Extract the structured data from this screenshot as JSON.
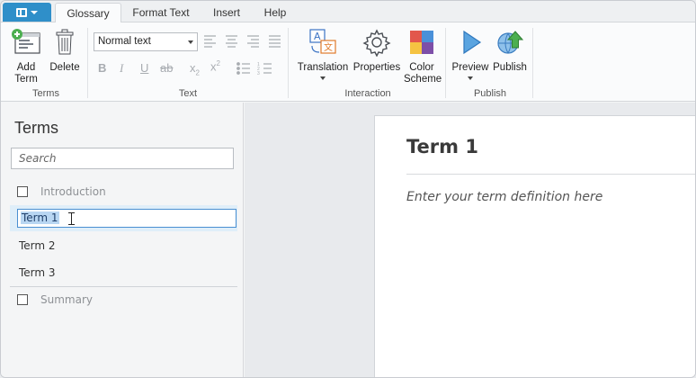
{
  "tabs": [
    "Glossary",
    "Format Text",
    "Insert",
    "Help"
  ],
  "ribbon": {
    "terms_group": {
      "label": "Terms",
      "add_term": "Add Term",
      "add_term_l1": "Add",
      "add_term_l2": "Term",
      "delete": "Delete"
    },
    "text_group": {
      "label": "Text",
      "style_value": "Normal text"
    },
    "interaction_group": {
      "label": "Interaction",
      "translation": "Translation",
      "properties": "Properties",
      "color_l1": "Color",
      "color_l2": "Scheme"
    },
    "publish_group": {
      "label": "Publish",
      "preview": "Preview",
      "publish": "Publish"
    }
  },
  "terms_panel": {
    "title": "Terms",
    "search_placeholder": "Search",
    "items": [
      {
        "label": "Introduction",
        "type": "intro"
      },
      {
        "label": "Term 1",
        "type": "term",
        "editing": true
      },
      {
        "label": "Term 2",
        "type": "term"
      },
      {
        "label": "Term 3",
        "type": "term"
      },
      {
        "label": "Summary",
        "type": "summary"
      }
    ]
  },
  "editor": {
    "term_title": "Term 1",
    "definition_placeholder": "Enter your term definition here"
  }
}
